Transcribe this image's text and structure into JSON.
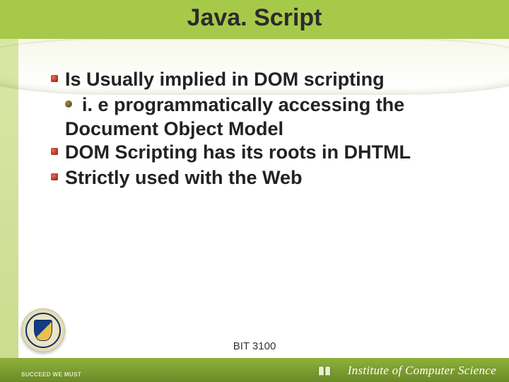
{
  "title": "Java. Script",
  "bullets": {
    "b1": "Is Usually implied in DOM scripting",
    "b1_sub": "i. e  programmatically  accessing  the",
    "b1_sub_cont": "Document Object Model",
    "b2": "DOM Scripting has its roots in DHTML",
    "b3": "Strictly used with the Web"
  },
  "footer": {
    "course_code": "BIT 3100",
    "motto": "SUCCEED WE MUST",
    "institute": "Institute of Computer Science"
  }
}
